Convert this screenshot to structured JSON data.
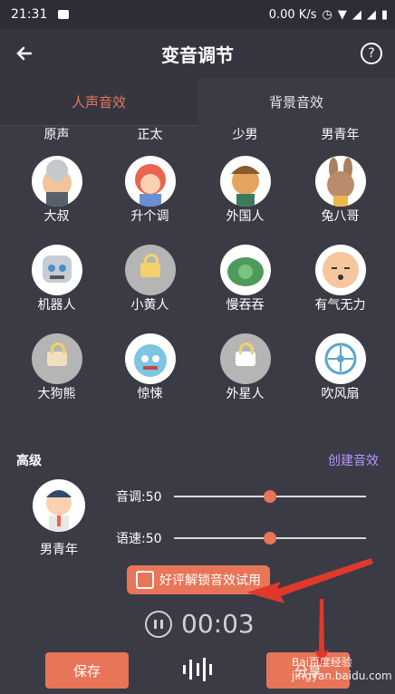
{
  "status": {
    "time": "21:31",
    "speed": "0.00 K/s"
  },
  "header": {
    "title": "变音调节",
    "help": "?"
  },
  "tabs": [
    {
      "label": "人声音效"
    },
    {
      "label": "背景音效"
    }
  ],
  "top_labels": [
    "原声",
    "正太",
    "少男",
    "男青年"
  ],
  "effects": [
    {
      "label": "大叔"
    },
    {
      "label": "升个调"
    },
    {
      "label": "外国人"
    },
    {
      "label": "兔八哥"
    },
    {
      "label": "机器人"
    },
    {
      "label": "小黄人"
    },
    {
      "label": "慢吞吞"
    },
    {
      "label": "有气无力"
    },
    {
      "label": "大狗熊"
    },
    {
      "label": "惊悚"
    },
    {
      "label": "外星人"
    },
    {
      "label": "吹风扇"
    }
  ],
  "advanced": {
    "title": "高级",
    "create_link": "创建音效",
    "selected_voice": "男青年",
    "pitch_label": "音调:50",
    "speed_label": "语速:50",
    "pitch_value": 50,
    "speed_value": 50
  },
  "unlock_button": "好评解锁音效试用",
  "timer": "00:03",
  "buttons": {
    "save": "保存",
    "share": "分享"
  },
  "watermark": "Bai百度经验 jingyan.baidu.com",
  "colors": {
    "accent": "#e87558",
    "background": "#3b3b46",
    "link": "#b794ff"
  }
}
